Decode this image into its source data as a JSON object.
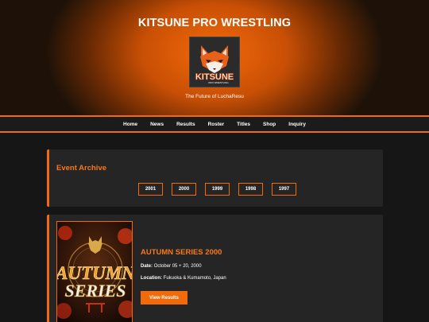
{
  "header": {
    "title": "KITSUNE PRO WRESTLING",
    "logo_text": "KITSUNE",
    "logo_subtext": "PRO WRESTLING",
    "tagline": "The Future of LuchaResu"
  },
  "nav": {
    "items": [
      "Home",
      "News",
      "Results",
      "Roster",
      "Titles",
      "Shop",
      "Inquiry"
    ]
  },
  "archive": {
    "title": "Event Archive",
    "years": [
      "2001",
      "2000",
      "1999",
      "1998",
      "1997"
    ]
  },
  "event": {
    "title": "AUTUMN SERIES 2000",
    "date_label": "Date:",
    "date_value": "October 05 + 20, 2000",
    "location_label": "Location:",
    "location_value": "Fukuoka & Kumamoto, Japan",
    "button_label": "View Results",
    "poster_text_top": "AUTUMN",
    "poster_text_bottom": "SERIES"
  },
  "colors": {
    "accent": "#f26a0a",
    "background": "#161616",
    "panel": "#252525"
  }
}
